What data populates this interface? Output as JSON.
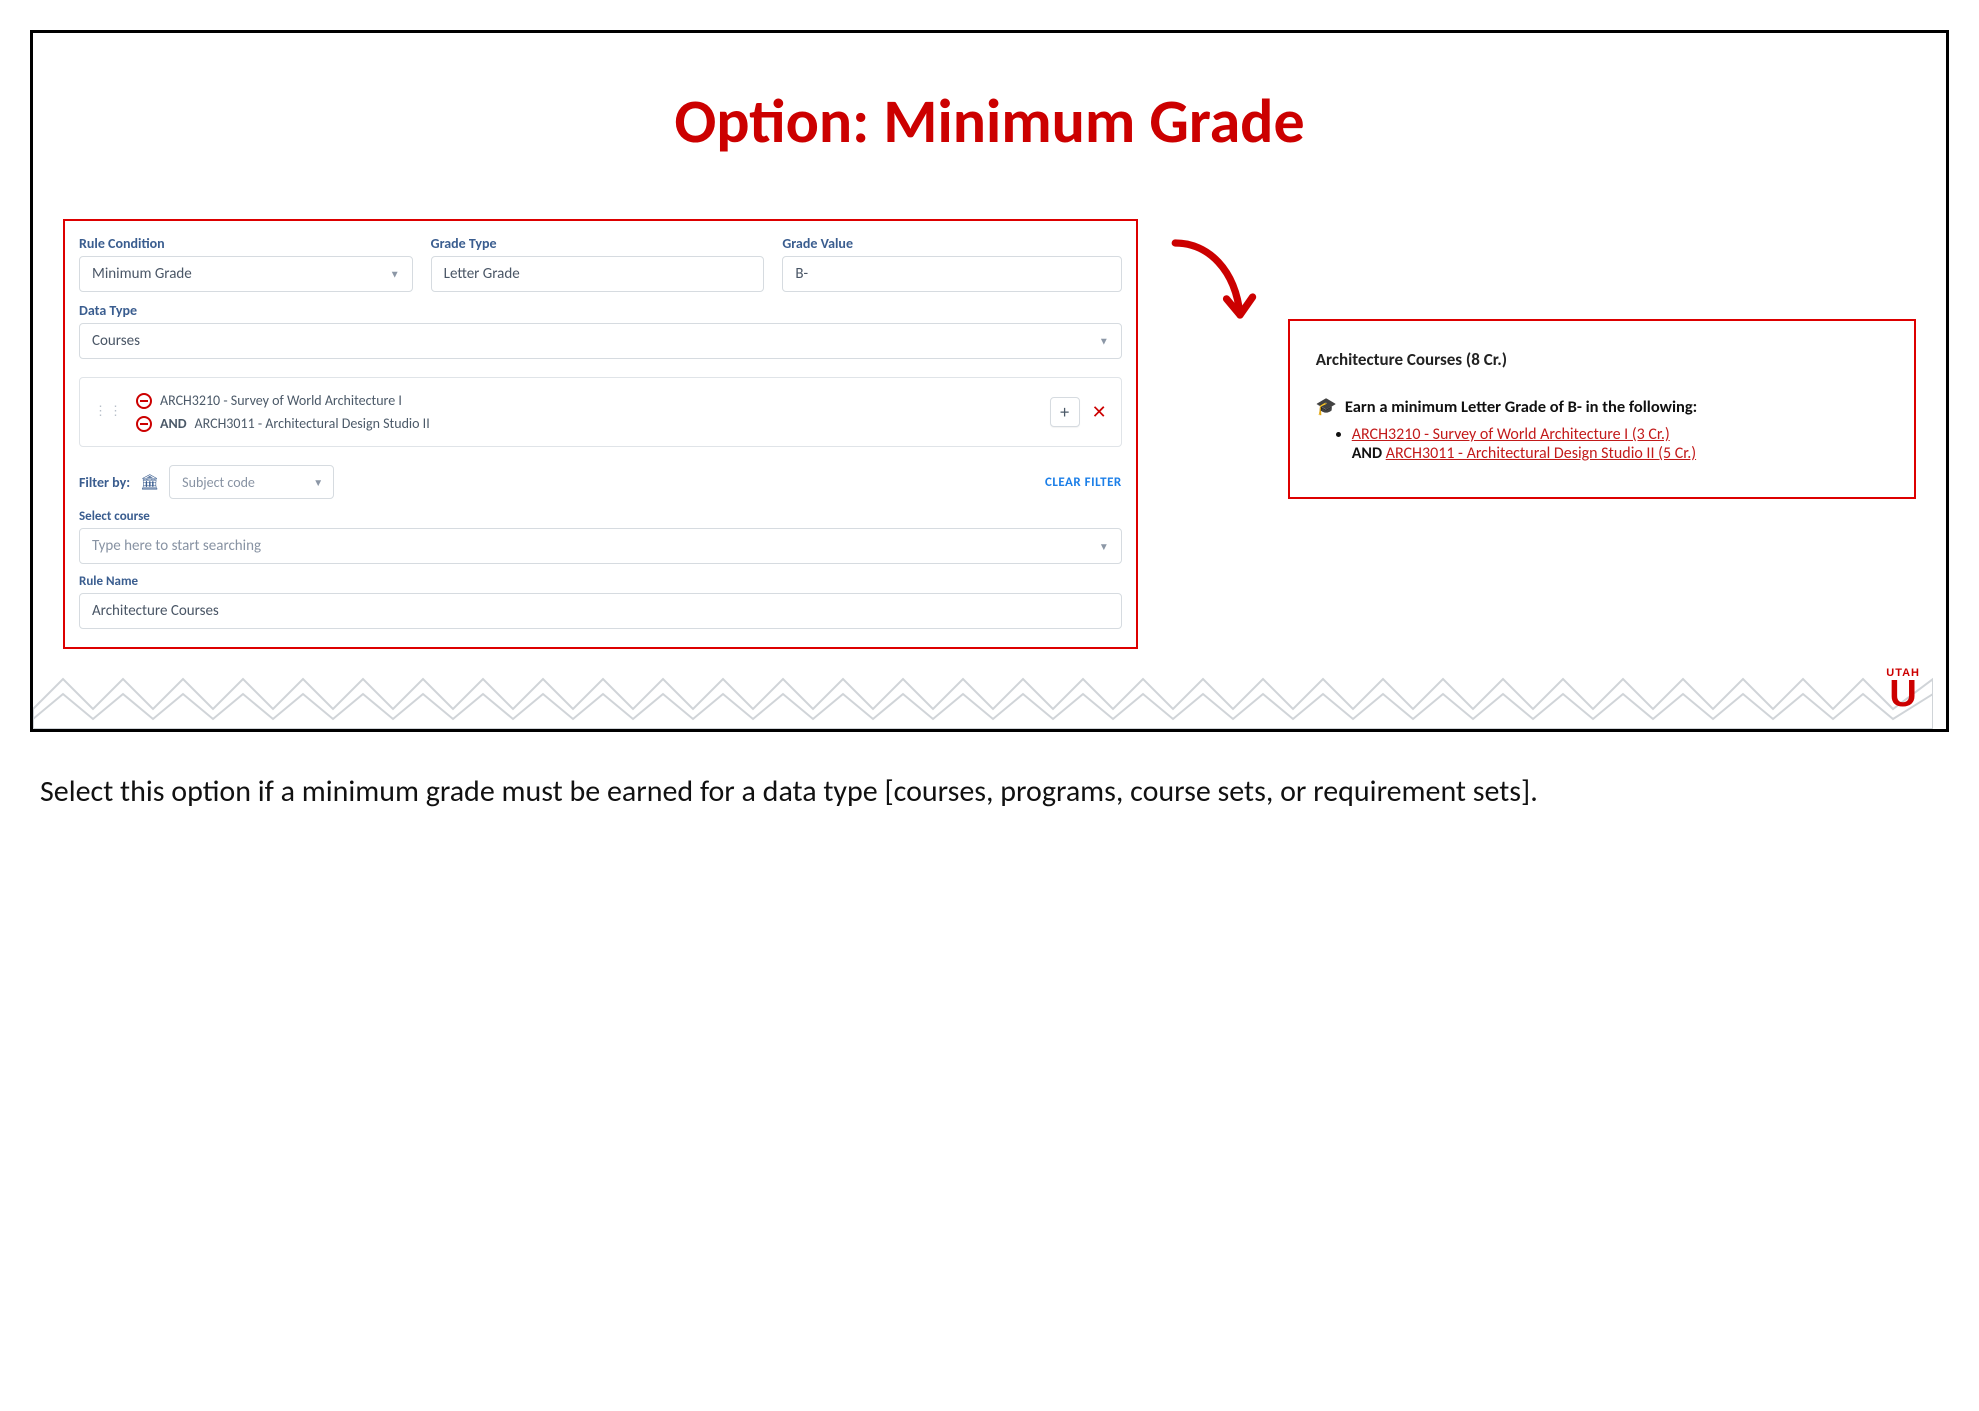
{
  "slide": {
    "title": "Option: Minimum Grade"
  },
  "form": {
    "ruleCondition": {
      "label": "Rule Condition",
      "value": "Minimum Grade"
    },
    "gradeType": {
      "label": "Grade Type",
      "value": "Letter Grade"
    },
    "gradeValue": {
      "label": "Grade Value",
      "value": "B-"
    },
    "dataType": {
      "label": "Data Type",
      "value": "Courses"
    },
    "courses": [
      {
        "text": "ARCH3210 - Survey of World Architecture I"
      },
      {
        "prefix": "AND",
        "text": "ARCH3011 - Architectural Design Studio II"
      }
    ],
    "filter": {
      "label": "Filter by:",
      "subjectPlaceholder": "Subject code",
      "clear": "CLEAR FILTER"
    },
    "selectCourse": {
      "label": "Select course",
      "placeholder": "Type here to start searching"
    },
    "ruleName": {
      "label": "Rule Name",
      "value": "Architecture Courses"
    }
  },
  "preview": {
    "heading": "Architecture Courses (8 Cr.)",
    "earnLine": "Earn a minimum Letter Grade of B- in the following:",
    "items": [
      {
        "link": "ARCH3210 - Survey of World Architecture I (3 Cr.)"
      },
      {
        "prefix": "AND",
        "link": "ARCH3011 - Architectural Design Studio II (5 Cr.)"
      }
    ]
  },
  "logo": {
    "small": "UTAH",
    "big": "U"
  },
  "caption": "Select this option if a minimum grade must be earned for a data type [courses, programs, course sets, or requirement sets]."
}
